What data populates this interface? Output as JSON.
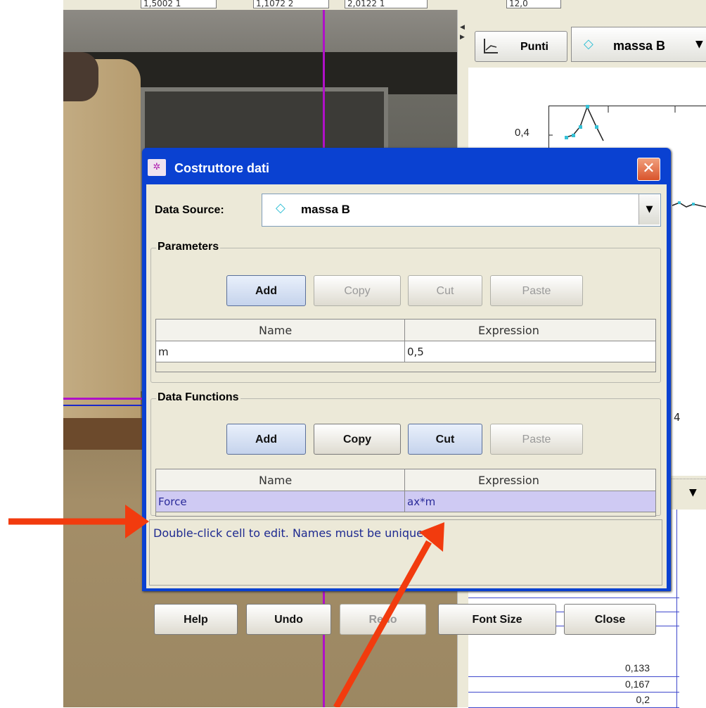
{
  "top_strip": {
    "field_1": "1,5002 1",
    "field_2": "1,1072 2",
    "field_3": "2,0122 1",
    "label": "",
    "field_4": "12,0"
  },
  "plot_panel": {
    "type_button_label": "Punti",
    "track_select_label": "massa B",
    "y_tick": "0,4",
    "side_tick": "4"
  },
  "data_table": {
    "values": [
      "0,133",
      "0,167",
      "0,2"
    ]
  },
  "dialog": {
    "title": "Costruttore dati",
    "data_source_label": "Data Source:",
    "data_source_value": "massa B",
    "parameters": {
      "title": "Parameters",
      "buttons": {
        "add": "Add",
        "copy": "Copy",
        "cut": "Cut",
        "paste": "Paste"
      },
      "columns": {
        "name": "Name",
        "expression": "Expression"
      },
      "rows": [
        {
          "name": "m",
          "expression": "0,5"
        }
      ]
    },
    "data_functions": {
      "title": "Data Functions",
      "buttons": {
        "add": "Add",
        "copy": "Copy",
        "cut": "Cut",
        "paste": "Paste"
      },
      "columns": {
        "name": "Name",
        "expression": "Expression"
      },
      "rows": [
        {
          "name": "Force",
          "expression": "ax*m"
        }
      ]
    },
    "hint": "Double-click cell to edit. Names must be unique.",
    "footer_buttons": {
      "help": "Help",
      "undo": "Undo",
      "redo": "Redo",
      "font_size": "Font Size",
      "close": "Close"
    }
  },
  "colors": {
    "title_bar": "#0a41d1",
    "annotation_arrow": "#f23b0e",
    "track_marker": "#b010c8",
    "selected_row": "#cfcaf3"
  },
  "icons": {
    "dialog_icon": "data-builder-icon",
    "close": "close-icon",
    "track": "diamond-icon",
    "plot_type": "axes-icon",
    "dropdown": "chevron-down-icon"
  }
}
